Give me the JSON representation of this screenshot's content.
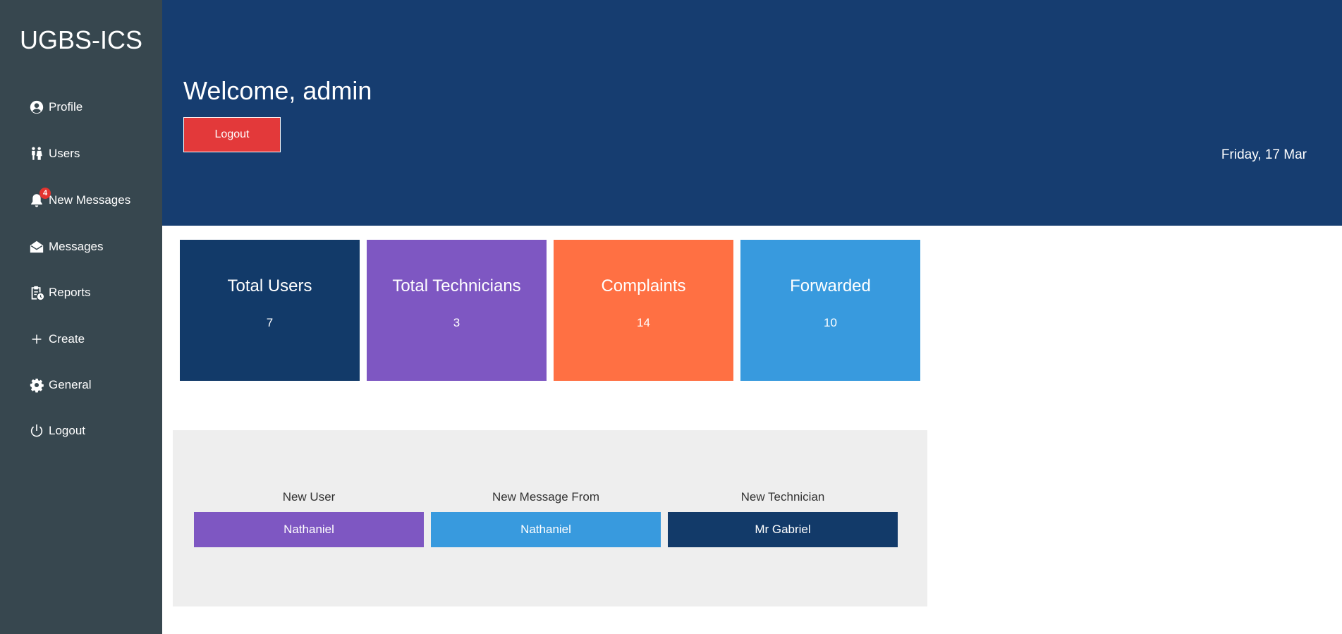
{
  "app": {
    "brand": "UGBS-ICS"
  },
  "sidebar": {
    "items": [
      {
        "label": "Profile",
        "icon": "profile-icon"
      },
      {
        "label": "Users",
        "icon": "users-icon"
      },
      {
        "label": "New Messages",
        "icon": "bell-icon",
        "badge": "4"
      },
      {
        "label": "Messages",
        "icon": "envelope-icon"
      },
      {
        "label": "Reports",
        "icon": "clipboard-clock-icon"
      },
      {
        "label": "Create",
        "icon": "plus-icon"
      },
      {
        "label": "General",
        "icon": "gear-icon"
      },
      {
        "label": "Logout",
        "icon": "power-icon"
      }
    ]
  },
  "header": {
    "welcome": "Welcome, admin",
    "logout_label": "Logout",
    "date": "Friday, 17 Mar"
  },
  "stats": [
    {
      "title": "Total Users",
      "value": "7",
      "color": "#123a69"
    },
    {
      "title": "Total Technicians",
      "value": "3",
      "color": "#7e57c2"
    },
    {
      "title": "Complaints",
      "value": "14",
      "color": "#ff7043"
    },
    {
      "title": "Forwarded",
      "value": "10",
      "color": "#389ade"
    }
  ],
  "recent": [
    {
      "label": "New User",
      "value": "Nathaniel",
      "color": "#7e57c2"
    },
    {
      "label": "New Message From",
      "value": "Nathaniel",
      "color": "#389ade"
    },
    {
      "label": "New Technician",
      "value": "Mr Gabriel",
      "color": "#123a69"
    }
  ],
  "colors": {
    "sidebar_bg": "#37474f",
    "header_bg": "#163d70",
    "logout_button": "#e3393a",
    "badge": "#e3342f",
    "panel_bg": "#eeeeee"
  }
}
